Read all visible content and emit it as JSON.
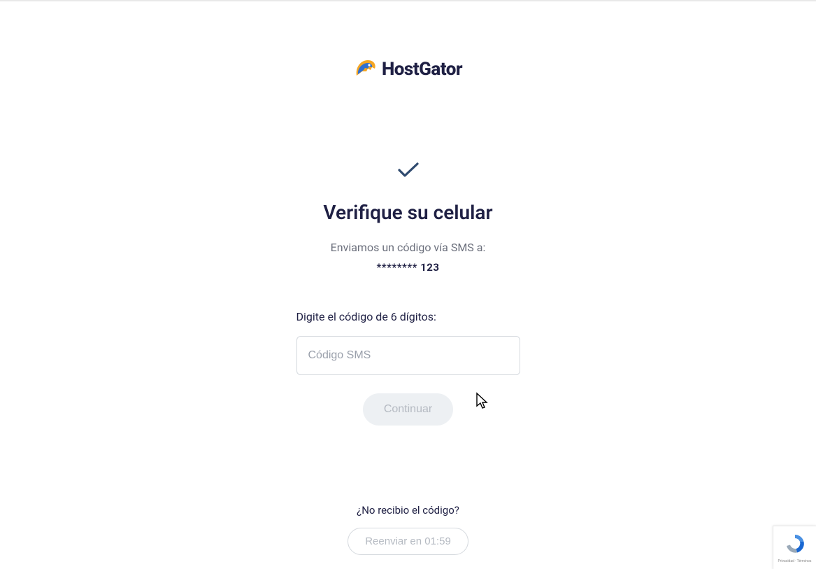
{
  "brand": {
    "name": "HostGator"
  },
  "verify": {
    "title": "Verifique su celular",
    "subtitle": "Enviamos un código vía SMS a:",
    "masked_phone": "******** 123",
    "input_label": "Digite el código de 6 dígitos:",
    "input_placeholder": "Código SMS",
    "continue_label": "Continuar",
    "no_code_label": "¿No recibio el código?",
    "resend_label": "Reenviar en 01:59"
  },
  "recaptcha": {
    "terms": "Privacidad · Términos"
  }
}
